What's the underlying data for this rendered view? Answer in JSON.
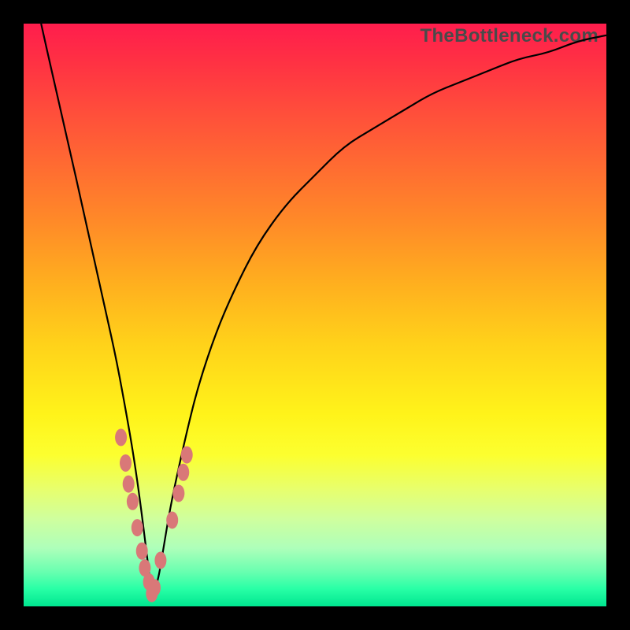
{
  "watermark": "TheBottleneck.com",
  "colors": {
    "frame": "#000000",
    "curve": "#000000",
    "marker": "#d97878",
    "gradient_top": "#ff1d4d",
    "gradient_bottom": "#00e690"
  },
  "chart_data": {
    "type": "line",
    "title": "",
    "xlabel": "",
    "ylabel": "",
    "xlim": [
      0,
      100
    ],
    "ylim": [
      0,
      100
    ],
    "vertex_x": 22,
    "series": [
      {
        "name": "bottleneck-curve",
        "x": [
          3,
          5,
          8,
          10,
          12,
          14,
          16,
          18,
          19,
          20,
          21,
          22,
          23,
          24,
          25,
          26,
          28,
          30,
          33,
          36,
          40,
          45,
          50,
          55,
          60,
          65,
          70,
          75,
          80,
          85,
          90,
          95,
          100
        ],
        "y": [
          100,
          91,
          78,
          69,
          60,
          51,
          42,
          31,
          25,
          18,
          10,
          2,
          4,
          10,
          16,
          21,
          30,
          38,
          47,
          54,
          62,
          69,
          74,
          79,
          82,
          85,
          88,
          90,
          92,
          94,
          95,
          97,
          98
        ]
      }
    ],
    "markers": {
      "name": "highlight-dots",
      "x": [
        16.7,
        17.5,
        18.0,
        18.7,
        19.5,
        20.3,
        20.8,
        21.5,
        22.0,
        22.5,
        23.5,
        25.5,
        26.6,
        27.4,
        28.0
      ],
      "y": [
        29.0,
        24.6,
        21.0,
        18.0,
        13.5,
        9.5,
        6.6,
        4.2,
        2.2,
        3.2,
        7.9,
        14.8,
        19.4,
        23.0,
        26.0
      ]
    }
  }
}
